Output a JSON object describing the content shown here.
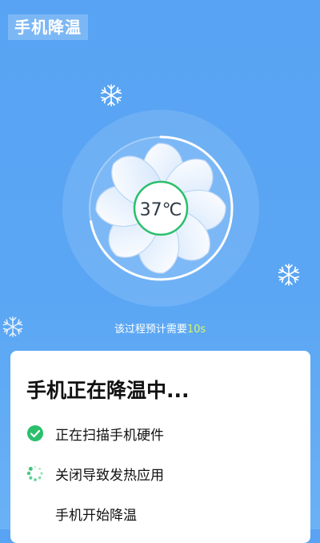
{
  "app": {
    "title": "手机降温"
  },
  "fan": {
    "temperature": "37℃",
    "progress": 0.72
  },
  "timer": {
    "prefix": "该过程预计需要",
    "seconds": "10s"
  },
  "card": {
    "title": "手机正在降温中...",
    "steps": [
      {
        "label": "正在扫描手机硬件",
        "status": "done",
        "icon": "check-circle-icon"
      },
      {
        "label": "关闭导致发热应用",
        "status": "in-progress",
        "icon": "loading-spinner-icon"
      },
      {
        "label": "手机开始降温",
        "status": "pending",
        "icon": ""
      }
    ]
  },
  "colors": {
    "bg": "#58a3f3",
    "accent": "#2bbf6c",
    "highlight": "#d8f56a"
  }
}
